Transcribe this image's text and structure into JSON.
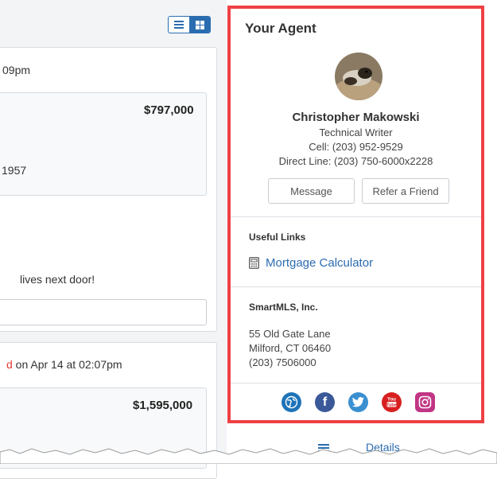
{
  "left": {
    "time_fragment_1": "09pm",
    "price_1": "$797,000",
    "year_fragment": "1957",
    "comment_fragment": "lives next door!",
    "red_fragment": "d",
    "time_fragment_2": " on Apr 14 at 02:07pm",
    "price_2": "$1,595,000",
    "view_toggle": {
      "list_icon": "list-icon",
      "grid_icon": "grid-icon",
      "active": "grid"
    }
  },
  "agent_panel": {
    "title": "Your Agent",
    "name": "Christopher Makowski",
    "role": "Technical Writer",
    "cell": "Cell: (203) 952-9529",
    "direct": "Direct Line: (203) 750-6000x2228",
    "message_button": "Message",
    "refer_button": "Refer a Friend",
    "useful_links_title": "Useful Links",
    "mortgage_link": "Mortgage Calculator",
    "office": {
      "name": "SmartMLS, Inc.",
      "address1": "55 Old Gate Lane",
      "address2": "Milford, CT 06460",
      "phone": "(203) 7506000"
    },
    "social": [
      "website-icon",
      "facebook-icon",
      "twitter-icon",
      "youtube-icon",
      "instagram-icon"
    ],
    "border_color": "#ef4044"
  },
  "below_panel_link": "Details"
}
